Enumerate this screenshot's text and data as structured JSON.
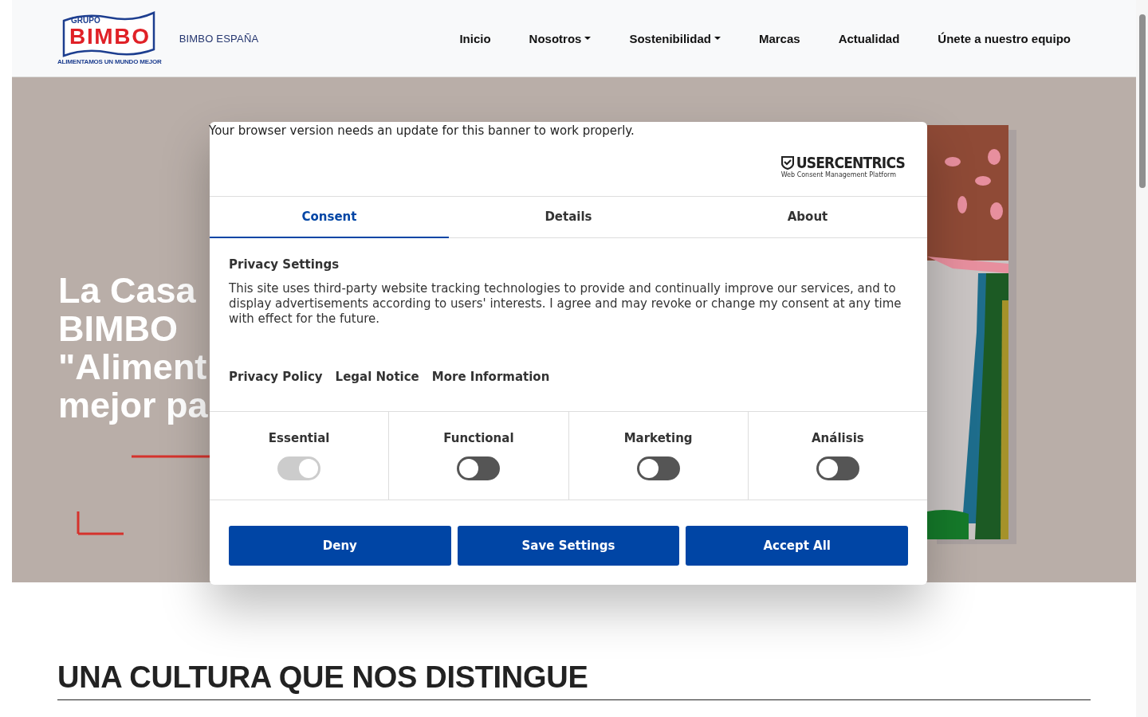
{
  "header": {
    "logo": {
      "top": "GRUPO",
      "name": "BIMBO",
      "tagline": "ALIMENTAMOS UN MUNDO MEJOR"
    },
    "site_name": "BIMBO ESPAÑA",
    "nav": [
      {
        "label": "Inicio",
        "dropdown": false
      },
      {
        "label": "Nosotros",
        "dropdown": true
      },
      {
        "label": "Sostenibilidad",
        "dropdown": true
      },
      {
        "label": "Marcas",
        "dropdown": false
      },
      {
        "label": "Actualidad",
        "dropdown": false
      },
      {
        "label": "Únete a nuestro equipo",
        "dropdown": false
      }
    ]
  },
  "hero": {
    "kind": "picture",
    "heading_lines": [
      "La Casa",
      "BIMBO",
      "\"Aliment",
      "mejor pa"
    ]
  },
  "consent": {
    "notice": "Your browser version needs an update for this banner to work properly.",
    "brand": {
      "name": "USERCENTRICS",
      "tagline": "Web Consent Management Platform"
    },
    "tabs": [
      {
        "label": "Consent",
        "selected": true
      },
      {
        "label": "Details",
        "selected": false
      },
      {
        "label": "About",
        "selected": false
      }
    ],
    "title": "Privacy Settings",
    "body": "This site uses third-party website tracking technologies to provide and continually improve our services, and to display advertisements according to users' interests. I agree and may revoke or change my consent at any time with effect for the future.",
    "links": [
      "Privacy Policy",
      "Legal Notice",
      "More Information"
    ],
    "categories": [
      {
        "label": "Essential",
        "on": true,
        "disabled": true
      },
      {
        "label": "Functional",
        "on": false,
        "disabled": false
      },
      {
        "label": "Marketing",
        "on": false,
        "disabled": false
      },
      {
        "label": "Análisis",
        "on": false,
        "disabled": false
      }
    ],
    "buttons": [
      "Deny",
      "Save Settings",
      "Accept All"
    ]
  },
  "section": {
    "heading": "UNA CULTURA QUE NOS DISTINGUE"
  }
}
